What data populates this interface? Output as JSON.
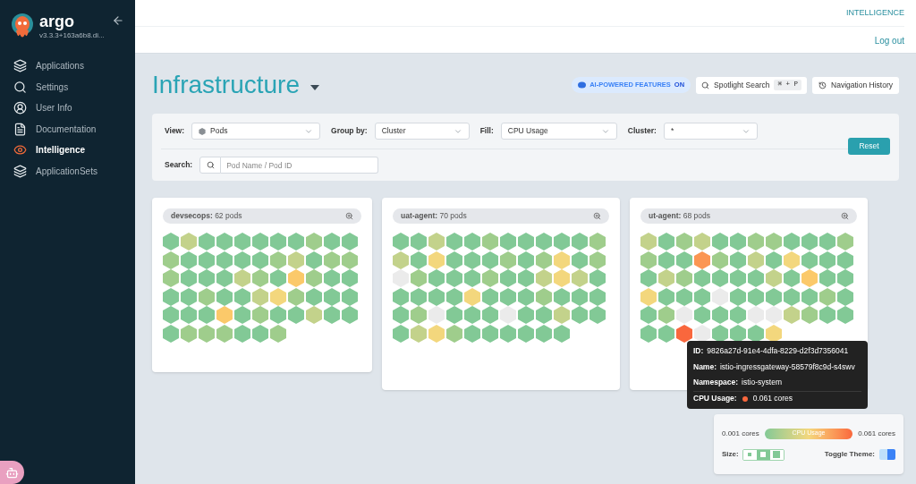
{
  "sidebar": {
    "brand": "argo",
    "version": "v3.3.3+163a6b8.di...",
    "items": [
      {
        "label": "Applications",
        "selected": false
      },
      {
        "label": "Settings",
        "selected": false
      },
      {
        "label": "User Info",
        "selected": false
      },
      {
        "label": "Documentation",
        "selected": false
      },
      {
        "label": "Intelligence",
        "selected": true
      },
      {
        "label": "ApplicationSets",
        "selected": false
      }
    ]
  },
  "topbar": {
    "link": "INTELLIGENCE",
    "logout": "Log out"
  },
  "header": {
    "title": "Infrastructure",
    "ai_badge": {
      "label": "AI-POWERED FEATURES",
      "state": "ON"
    },
    "spotlight": {
      "label": "Spotlight Search",
      "shortcut": "⌘ + P"
    },
    "history": "Navigation History"
  },
  "filters": [
    {
      "label": "View:",
      "value": "Pods"
    },
    {
      "label": "Group by:",
      "value": "Cluster"
    },
    {
      "label": "Fill:",
      "value": "CPU Usage"
    },
    {
      "label": "Cluster:",
      "value": "*"
    }
  ],
  "search": {
    "label": "Search:",
    "placeholder": "Pod Name / Pod ID"
  },
  "reset": "Reset",
  "clusters": [
    {
      "label": "**devsecops:** 62 pods",
      "pods": [
        {
          "color": "#82c996"
        },
        {
          "color": "#c3d28b"
        },
        {
          "color": "#82c996"
        },
        {
          "color": "#82c996"
        },
        {
          "color": "#82c996"
        },
        {
          "color": "#82c996"
        },
        {
          "color": "#82c996"
        },
        {
          "color": "#82c996"
        },
        {
          "color": "#9fcd8c"
        },
        {
          "color": "#82c996"
        },
        {
          "color": "#82c996"
        },
        {
          "color": "#9fcd8c"
        },
        {
          "color": "#82c996"
        },
        {
          "color": "#82c996"
        },
        {
          "color": "#82c996"
        },
        {
          "color": "#82c996"
        },
        {
          "color": "#82c996"
        },
        {
          "color": "#9fcd8c"
        },
        {
          "color": "#c3d28b"
        },
        {
          "color": "#82c996"
        },
        {
          "color": "#9fcd8c"
        },
        {
          "color": "#9fcd8c"
        },
        {
          "color": "#9fcd8c"
        },
        {
          "color": "#82c996"
        },
        {
          "color": "#82c996"
        },
        {
          "color": "#82c996"
        },
        {
          "color": "#c3d28b"
        },
        {
          "color": "#9fcd8c"
        },
        {
          "color": "#82c996"
        },
        {
          "color": "#fbc96a"
        },
        {
          "color": "#9fcd8c"
        },
        {
          "color": "#82c996"
        },
        {
          "color": "#82c996"
        },
        {
          "color": "#82c996"
        },
        {
          "color": "#82c996"
        },
        {
          "color": "#9fcd8c"
        },
        {
          "color": "#82c996"
        },
        {
          "color": "#82c996"
        },
        {
          "color": "#c3d28b"
        },
        {
          "color": "#f3d77d"
        },
        {
          "color": "#9fcd8c"
        },
        {
          "color": "#82c996"
        },
        {
          "color": "#82c996"
        },
        {
          "color": "#82c996"
        },
        {
          "color": "#82c996"
        },
        {
          "color": "#82c996"
        },
        {
          "color": "#82c996"
        },
        {
          "color": "#fbc96a"
        },
        {
          "color": "#82c996"
        },
        {
          "color": "#9fcd8c"
        },
        {
          "color": "#82c996"
        },
        {
          "color": "#82c996"
        },
        {
          "color": "#c3d28b"
        },
        {
          "color": "#82c996"
        },
        {
          "color": "#82c996"
        },
        {
          "color": "#82c996"
        },
        {
          "color": "#9fcd8c"
        },
        {
          "color": "#9fcd8c"
        },
        {
          "color": "#9fcd8c"
        },
        {
          "color": "#82c996"
        },
        {
          "color": "#82c996"
        },
        {
          "color": "#9fcd8c"
        }
      ]
    },
    {
      "label": "**uat-agent:** 70 pods",
      "pods": [
        {
          "color": "#82c996"
        },
        {
          "color": "#82c996"
        },
        {
          "color": "#c3d28b"
        },
        {
          "color": "#82c996"
        },
        {
          "color": "#82c996"
        },
        {
          "color": "#9fcd8c"
        },
        {
          "color": "#82c996"
        },
        {
          "color": "#82c996"
        },
        {
          "color": "#82c996"
        },
        {
          "color": "#82c996"
        },
        {
          "color": "#82c996"
        },
        {
          "color": "#9fcd8c"
        },
        {
          "color": "#c3d28b"
        },
        {
          "color": "#82c996"
        },
        {
          "color": "#f3d77d"
        },
        {
          "color": "#82c996"
        },
        {
          "color": "#82c996"
        },
        {
          "color": "#82c996"
        },
        {
          "color": "#9fcd8c"
        },
        {
          "color": "#82c996"
        },
        {
          "color": "#9fcd8c"
        },
        {
          "color": "#f3d77d"
        },
        {
          "color": "#82c996"
        },
        {
          "color": "#9fcd8c"
        },
        {
          "color": "#ebebeb"
        },
        {
          "color": "#9fcd8c"
        },
        {
          "color": "#82c996"
        },
        {
          "color": "#82c996"
        },
        {
          "color": "#82c996"
        },
        {
          "color": "#9fcd8c"
        },
        {
          "color": "#82c996"
        },
        {
          "color": "#82c996"
        },
        {
          "color": "#c3d28b"
        },
        {
          "color": "#f3d77d"
        },
        {
          "color": "#c3d28b"
        },
        {
          "color": "#82c996"
        },
        {
          "color": "#82c996"
        },
        {
          "color": "#82c996"
        },
        {
          "color": "#82c996"
        },
        {
          "color": "#82c996"
        },
        {
          "color": "#f3d77d"
        },
        {
          "color": "#82c996"
        },
        {
          "color": "#82c996"
        },
        {
          "color": "#82c996"
        },
        {
          "color": "#9fcd8c"
        },
        {
          "color": "#82c996"
        },
        {
          "color": "#82c996"
        },
        {
          "color": "#82c996"
        },
        {
          "color": "#82c996"
        },
        {
          "color": "#9fcd8c"
        },
        {
          "color": "#ebebeb"
        },
        {
          "color": "#82c996"
        },
        {
          "color": "#82c996"
        },
        {
          "color": "#82c996"
        },
        {
          "color": "#ebebeb"
        },
        {
          "color": "#82c996"
        },
        {
          "color": "#82c996"
        },
        {
          "color": "#c3d28b"
        },
        {
          "color": "#82c996"
        },
        {
          "color": "#82c996"
        },
        {
          "color": "#82c996"
        },
        {
          "color": "#c3d28b"
        },
        {
          "color": "#f3d77d"
        },
        {
          "color": "#9fcd8c"
        },
        {
          "color": "#82c996"
        },
        {
          "color": "#82c996"
        },
        {
          "color": "#82c996"
        },
        {
          "color": "#82c996"
        },
        {
          "color": "#82c996"
        },
        {
          "color": "#82c996"
        }
      ]
    },
    {
      "label": "**ut-agent:** 68 pods",
      "pods": [
        {
          "color": "#c3d28b"
        },
        {
          "color": "#82c996"
        },
        {
          "color": "#9fcd8c"
        },
        {
          "color": "#c3d28b"
        },
        {
          "color": "#82c996"
        },
        {
          "color": "#82c996"
        },
        {
          "color": "#9fcd8c"
        },
        {
          "color": "#9fcd8c"
        },
        {
          "color": "#82c996"
        },
        {
          "color": "#82c996"
        },
        {
          "color": "#82c996"
        },
        {
          "color": "#9fcd8c"
        },
        {
          "color": "#9fcd8c"
        },
        {
          "color": "#82c996"
        },
        {
          "color": "#82c996"
        },
        {
          "color": "#fb9653"
        },
        {
          "color": "#9fcd8c"
        },
        {
          "color": "#82c996"
        },
        {
          "color": "#c3d28b"
        },
        {
          "color": "#82c996"
        },
        {
          "color": "#f3d77d"
        },
        {
          "color": "#82c996"
        },
        {
          "color": "#82c996"
        },
        {
          "color": "#82c996"
        },
        {
          "color": "#82c996"
        },
        {
          "color": "#c3d28b"
        },
        {
          "color": "#9fcd8c"
        },
        {
          "color": "#82c996"
        },
        {
          "color": "#82c996"
        },
        {
          "color": "#82c996"
        },
        {
          "color": "#82c996"
        },
        {
          "color": "#c3d28b"
        },
        {
          "color": "#82c996"
        },
        {
          "color": "#fbc96a"
        },
        {
          "color": "#82c996"
        },
        {
          "color": "#82c996"
        },
        {
          "color": "#f3d77d"
        },
        {
          "color": "#82c996"
        },
        {
          "color": "#82c996"
        },
        {
          "color": "#82c996"
        },
        {
          "color": "#ebebeb"
        },
        {
          "color": "#82c996"
        },
        {
          "color": "#82c996"
        },
        {
          "color": "#82c996"
        },
        {
          "color": "#82c996"
        },
        {
          "color": "#82c996"
        },
        {
          "color": "#9fcd8c"
        },
        {
          "color": "#82c996"
        },
        {
          "color": "#82c996"
        },
        {
          "color": "#9fcd8c"
        },
        {
          "color": "#ebebeb"
        },
        {
          "color": "#82c996"
        },
        {
          "color": "#82c996"
        },
        {
          "color": "#82c996"
        },
        {
          "color": "#ebebeb"
        },
        {
          "color": "#ebebeb"
        },
        {
          "color": "#c3d28b"
        },
        {
          "color": "#9fcd8c"
        },
        {
          "color": "#82c996"
        },
        {
          "color": "#82c996"
        },
        {
          "color": "#82c996"
        },
        {
          "color": "#82c996"
        },
        {
          "color": "#f9673d"
        },
        {
          "color": "#ebebeb"
        },
        {
          "color": "#82c996"
        },
        {
          "color": "#82c996"
        },
        {
          "color": "#82c996"
        },
        {
          "color": "#f3d77d"
        }
      ]
    }
  ],
  "tooltip": {
    "rows": [
      {
        "label": "ID:",
        "value": "9826a27d-91e4-4dfa-8229-d2f3d7356041"
      },
      {
        "label": "Name:",
        "value": "istio-ingressgateway-58579f8c9d-s4swv"
      },
      {
        "label": "Namespace:",
        "value": "istio-system"
      },
      {
        "label": "CPU Usage:",
        "value": "0.061 cores",
        "color": "#f9673d"
      }
    ]
  },
  "legend": {
    "min": "0.001 cores",
    "bar": "CPU Usage",
    "max": "0.061 cores",
    "size_label": "Size:",
    "sizes": [
      {
        "selected": false
      },
      {
        "selected": true
      },
      {
        "selected": false
      }
    ],
    "theme_label": "Toggle Theme:",
    "theme_dark": false
  }
}
